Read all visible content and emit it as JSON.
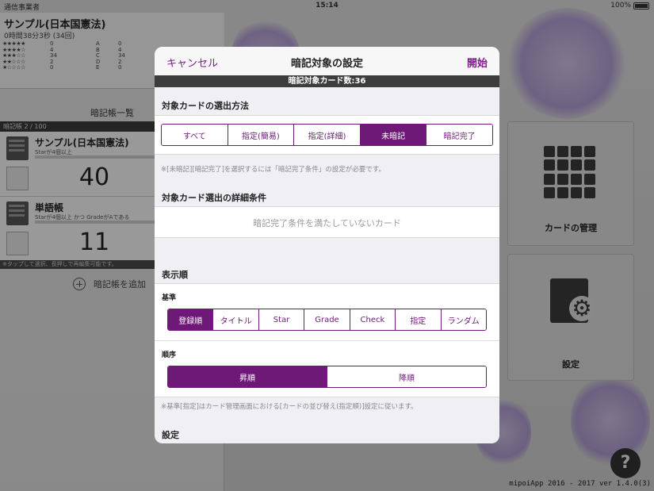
{
  "status_bar": {
    "carrier": "通信事業者",
    "time": "15:14",
    "battery": "100%"
  },
  "background": {
    "top_card": {
      "title": "サンプル(日本国憲法)",
      "time_line": "0時間38分3秒 (34回)",
      "star_rows": [
        {
          "stars": "★★★★★",
          "count": "0",
          "grade": "A",
          "gcount": "0"
        },
        {
          "stars": "★★★★☆",
          "count": "4",
          "grade": "B",
          "gcount": "4"
        },
        {
          "stars": "★★★☆☆",
          "count": "34",
          "grade": "C",
          "gcount": "34"
        },
        {
          "stars": "★★☆☆☆",
          "count": "2",
          "grade": "D",
          "gcount": "2"
        },
        {
          "stars": "★☆☆☆☆",
          "count": "0",
          "grade": "E",
          "gcount": "0"
        }
      ]
    },
    "list_header": "暗記帳一覧",
    "count_bar": "暗記帳 2 / 100",
    "decks": [
      {
        "name": "サンプル(日本国憲法)",
        "cond": "Starが4個以上",
        "num": "40"
      },
      {
        "name": "単語帳",
        "cond": "Starが4個以上 かつ GradeがAである",
        "num": "11"
      }
    ],
    "hint": "※タップして選択、長押しで再編集可能です。",
    "add_deck": "暗記帳を追加",
    "tiles": {
      "manage": "カードの管理",
      "settings": "設定"
    },
    "help": "?",
    "version": "mipoiApp 2016 - 2017 ver 1.4.0(3)"
  },
  "modal": {
    "cancel": "キャンセル",
    "title": "暗記対象の設定",
    "start": "開始",
    "count_bar": "暗記対象カード数:36",
    "selection": {
      "title": "対象カードの選出方法",
      "options": [
        "すべて",
        "指定(簡易)",
        "指定(詳細)",
        "未暗記",
        "暗記完了"
      ],
      "selected": "未暗記",
      "note": "※[未暗記][暗記完了]を選択するには「暗記完了条件」の設定が必要です。"
    },
    "detail": {
      "title": "対象カード選出の詳細条件",
      "condition_text": "暗記完了条件を満たしていないカード"
    },
    "order": {
      "title": "表示順",
      "basis_label": "基準",
      "basis_options": [
        "登録順",
        "タイトル",
        "Star",
        "Grade",
        "Check",
        "指定",
        "ランダム"
      ],
      "basis_selected": "登録順",
      "sequence_label": "順序",
      "sequence_options": [
        "昇順",
        "降順"
      ],
      "sequence_selected": "昇順",
      "note": "※基準[指定]はカード管理画面における[カードの並び替え(指定順)]設定に従います。"
    },
    "settings_title": "設定"
  }
}
